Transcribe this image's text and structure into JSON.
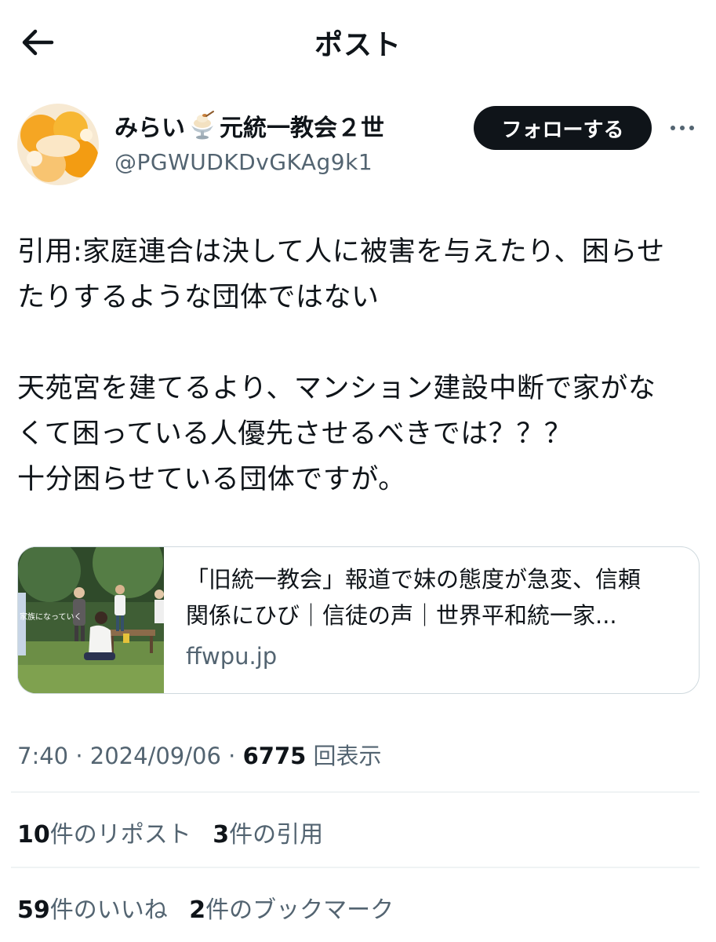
{
  "header": {
    "title": "ポスト"
  },
  "author": {
    "name_part1": "みらい",
    "name_emoji": "ice-cream-sundae-icon",
    "name_part2": "元統一教会２世",
    "handle": "@PGWUDKDvGKAg9k1",
    "follow_label": "フォローする"
  },
  "post": {
    "paragraph1": [
      "引用:家庭連合は決して人に被害を与えたり、困らせ",
      "たりするような団体ではない"
    ],
    "paragraph2": [
      "天苑宮を建てるより、マンション建設中断で家がな",
      "くて困っている人優先させるべきでは？？？",
      "十分困らせている団体ですが。"
    ]
  },
  "card": {
    "thumbnail_caption": "家族になっていく",
    "title_lines": [
      "「旧統一教会」報道で妹の態度が急変、信頼",
      "関係にひび｜信徒の声｜世界平和統一家..."
    ],
    "domain": "ffwpu.jp"
  },
  "meta": {
    "time": "7:40",
    "date": "2024/09/06",
    "views": "6775",
    "views_label": "回表示"
  },
  "stats": {
    "reposts": "10",
    "reposts_label": "件のリポスト",
    "quotes": "3",
    "quotes_label": "件の引用",
    "likes": "59",
    "likes_label": "件のいいね",
    "bookmarks": "2",
    "bookmarks_label": "件のブックマーク"
  },
  "colors": {
    "text": "#0f1419",
    "secondary": "#536471",
    "border": "#cfd9de",
    "divider": "#eff3f4"
  }
}
